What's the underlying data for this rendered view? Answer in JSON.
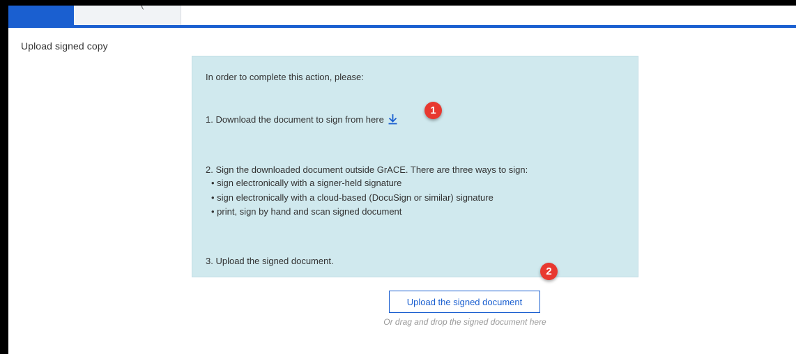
{
  "tabs": [
    {
      "label": "",
      "active": true
    },
    {
      "label": "(",
      "active": false
    }
  ],
  "section_title": "Upload signed copy",
  "instructions": {
    "intro": "In order to complete this action, please:",
    "step1_link": "1. Download the document to sign from here",
    "step1_icon": "download-icon",
    "step2": "2. Sign the downloaded document outside GrACE. There are three ways to sign:",
    "bullets": [
      "• sign electronically with a signer-held signature",
      "• sign electronically with a cloud-based (DocuSign or similar) signature",
      "• print, sign by hand and scan signed document"
    ],
    "step3": "3. Upload the signed document."
  },
  "badges": {
    "one": "1",
    "two": "2"
  },
  "upload": {
    "button_label": "Upload the signed document",
    "drag_hint": "Or drag and drop the signed document here"
  },
  "colors": {
    "accent": "#1a5fd0",
    "info_bg": "#d0e9ee",
    "badge": "#e8382f",
    "hint": "#999999"
  }
}
